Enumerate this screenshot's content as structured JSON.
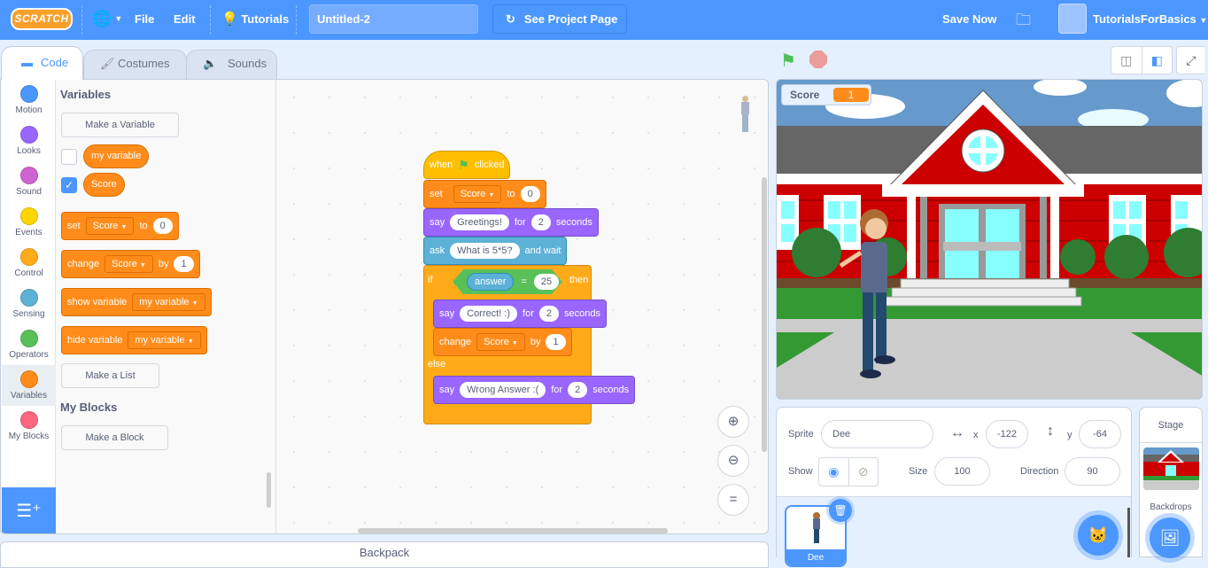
{
  "menubar": {
    "logo": "SCRATCH",
    "language_icon": "globe-icon",
    "file": "File",
    "edit": "Edit",
    "tutorials": "Tutorials",
    "project_title": "Untitled-2",
    "see_project_page": "See Project Page",
    "save_now": "Save Now",
    "username": "TutorialsForBasics"
  },
  "tabs": [
    {
      "label": "Code",
      "icon": "code-icon",
      "active": true
    },
    {
      "label": "Costumes",
      "icon": "brush-icon",
      "active": false
    },
    {
      "label": "Sounds",
      "icon": "speaker-icon",
      "active": false
    }
  ],
  "categories": [
    {
      "label": "Motion",
      "color": "#4c97ff"
    },
    {
      "label": "Looks",
      "color": "#9966ff"
    },
    {
      "label": "Sound",
      "color": "#cf63cf"
    },
    {
      "label": "Events",
      "color": "#ffd500"
    },
    {
      "label": "Control",
      "color": "#ffab19"
    },
    {
      "label": "Sensing",
      "color": "#5cb1d6"
    },
    {
      "label": "Operators",
      "color": "#59c059"
    },
    {
      "label": "Variables",
      "color": "#ff8c1a"
    },
    {
      "label": "My Blocks",
      "color": "#ff6680"
    }
  ],
  "active_category": "Variables",
  "palette": {
    "variables_heading": "Variables",
    "make_variable": "Make a Variable",
    "variables": [
      {
        "name": "my variable",
        "checked": false
      },
      {
        "name": "Score",
        "checked": true
      }
    ],
    "set_block": {
      "set": "set",
      "var": "Score",
      "to": "to",
      "value": "0"
    },
    "change_block": {
      "change": "change",
      "var": "Score",
      "by": "by",
      "value": "1"
    },
    "show_block": {
      "label": "show variable",
      "var": "my variable"
    },
    "hide_block": {
      "label": "hide variable",
      "var": "my variable"
    },
    "make_list": "Make a List",
    "my_blocks_heading": "My Blocks",
    "make_block": "Make a Block"
  },
  "script": {
    "hat": {
      "when": "when",
      "clicked": "clicked"
    },
    "set": {
      "set": "set",
      "var": "Score",
      "to": "to",
      "value": "0"
    },
    "say1": {
      "say": "say",
      "msg": "Greetings!",
      "for": "for",
      "secs": "2",
      "seconds": "seconds"
    },
    "ask": {
      "ask": "ask",
      "question": "What is 5*5?",
      "and_wait": "and wait"
    },
    "if": {
      "if": "if",
      "reporter": "answer",
      "eq": "=",
      "value": "25",
      "then": "then",
      "else": "else"
    },
    "say2": {
      "say": "say",
      "msg": "Correct! :)",
      "for": "for",
      "secs": "2",
      "seconds": "seconds"
    },
    "change": {
      "change": "change",
      "var": "Score",
      "by": "by",
      "value": "1"
    },
    "say3": {
      "say": "say",
      "msg": "Wrong Answer :(",
      "for": "for",
      "secs": "2",
      "seconds": "seconds"
    }
  },
  "zoom_controls": {
    "zoom_in": "+",
    "zoom_out": "−",
    "reset": "="
  },
  "backpack": "Backpack",
  "stage": {
    "monitor_label": "Score",
    "monitor_value": "1"
  },
  "sprite_info": {
    "sprite_label": "Sprite",
    "sprite_name": "Dee",
    "x_label": "x",
    "x": "-122",
    "y_label": "y",
    "y": "-64",
    "show_label": "Show",
    "size_label": "Size",
    "size": "100",
    "direction_label": "Direction",
    "direction": "90"
  },
  "sprites": [
    {
      "name": "Dee",
      "selected": true
    }
  ],
  "stage_panel": {
    "label": "Stage",
    "backdrops_label": "Backdrops"
  }
}
